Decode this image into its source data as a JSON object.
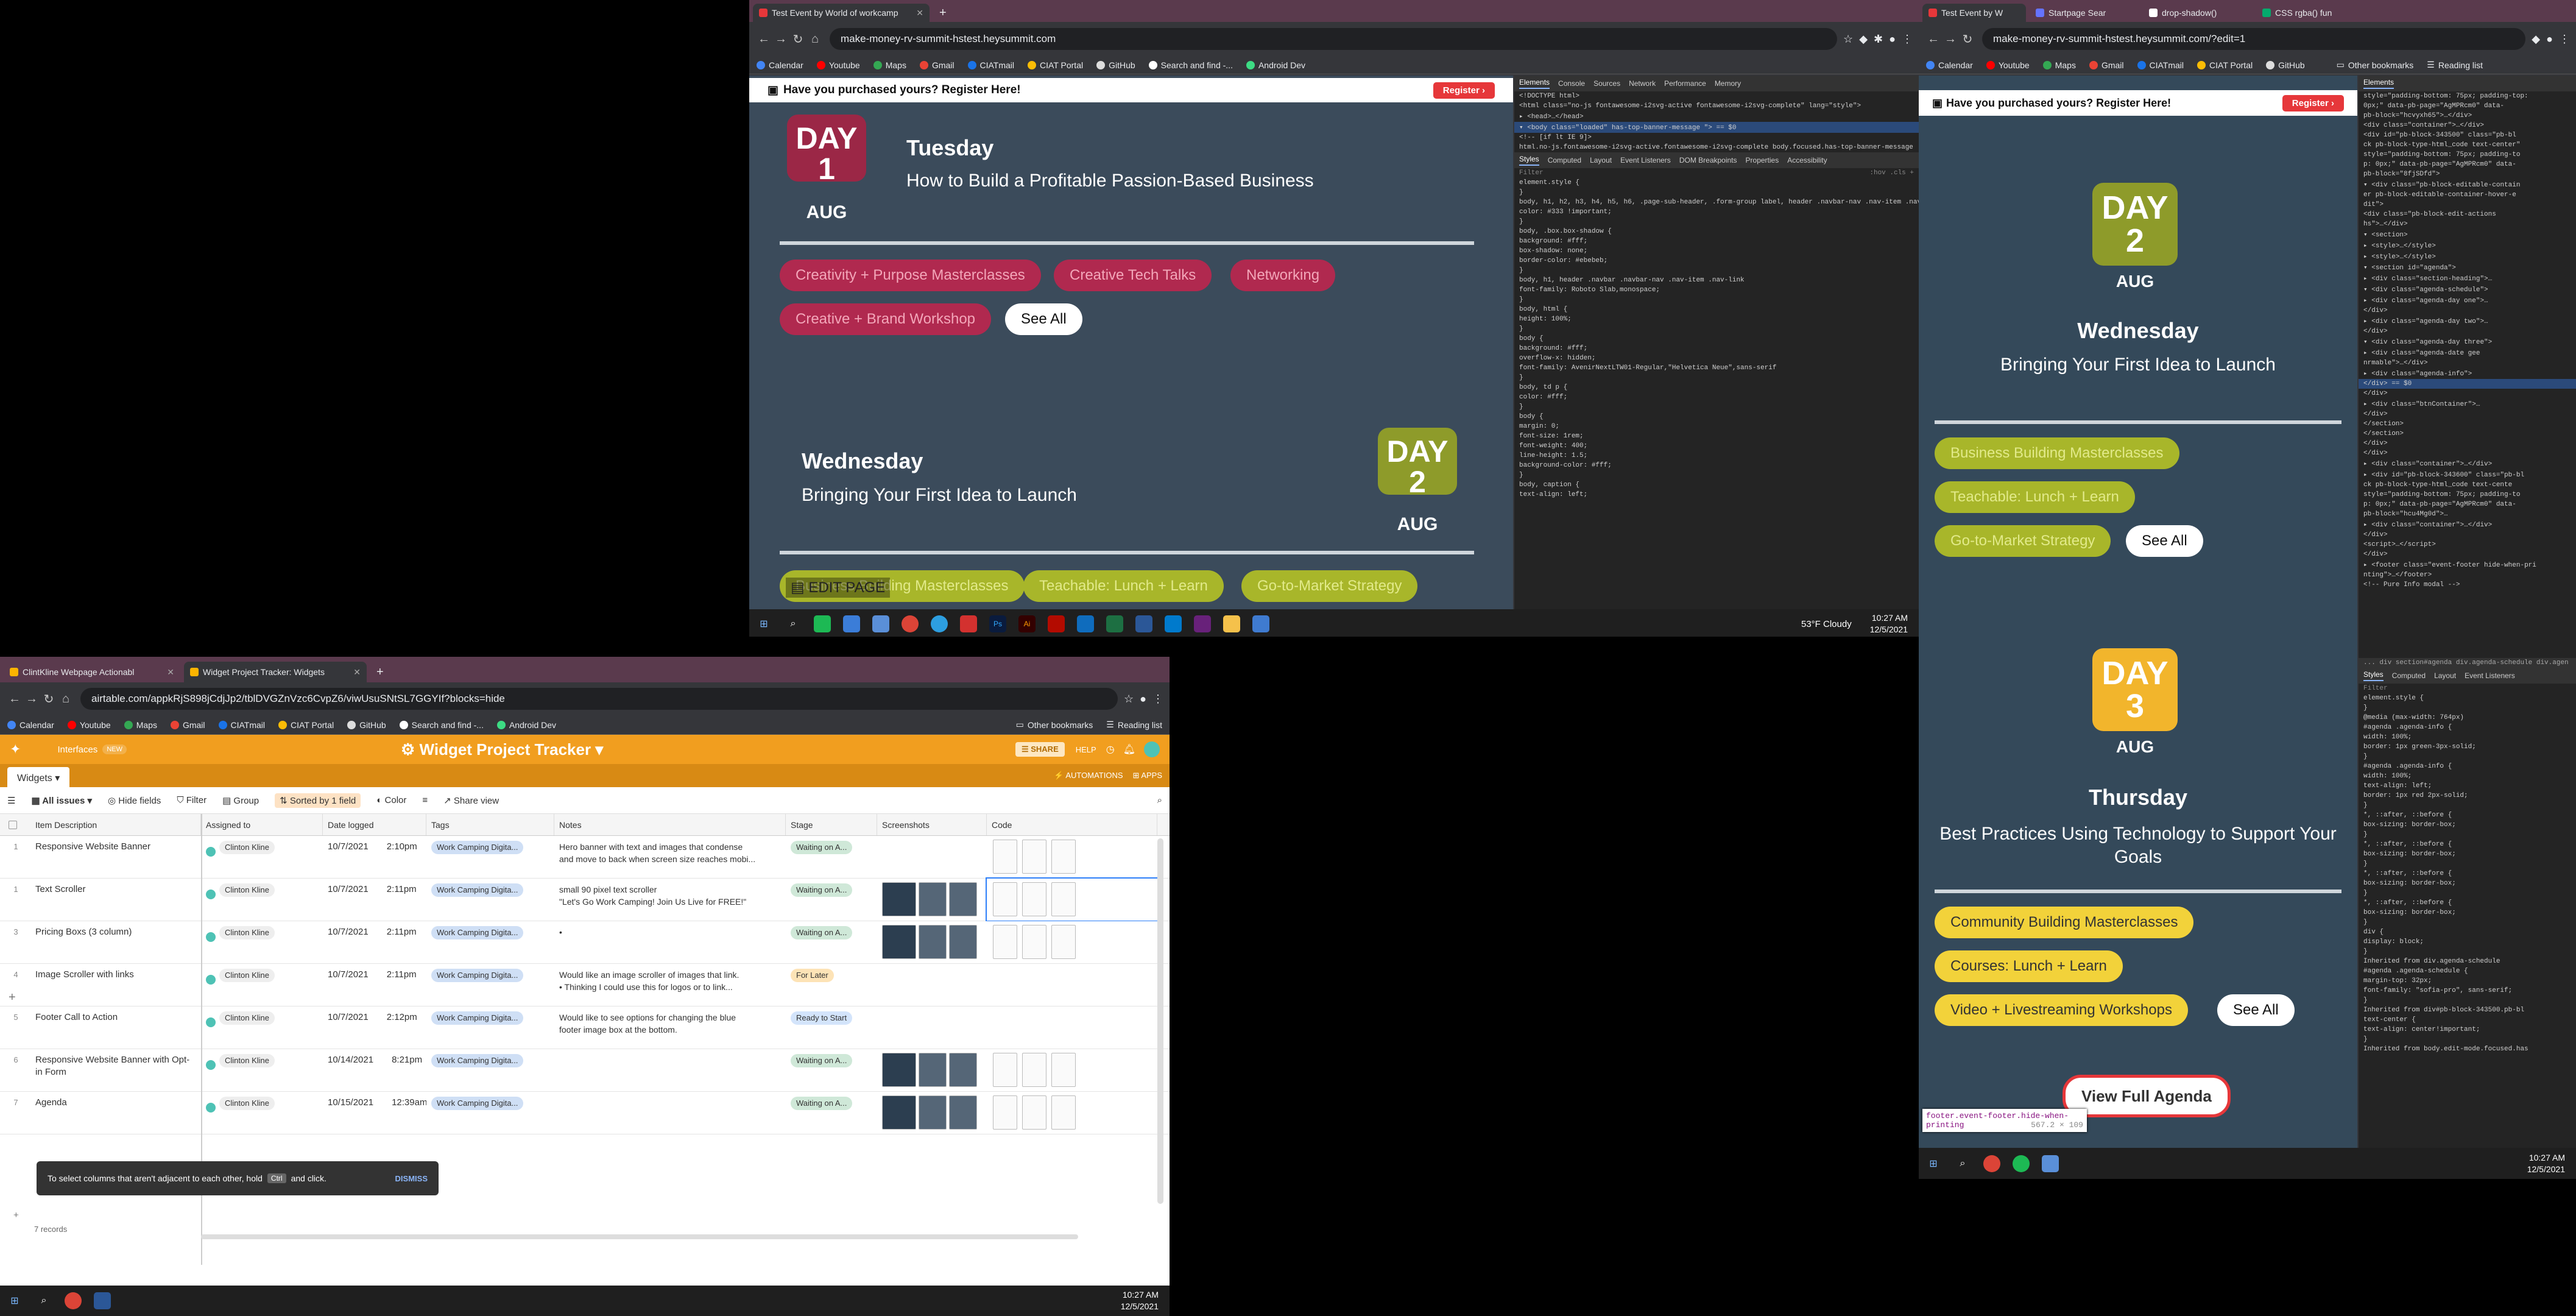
{
  "browser_top": {
    "tabs": [
      {
        "label": "Test Event by World of workcamp",
        "active": true
      }
    ],
    "url": "make-money-rv-summit-hstest.heysummit.com",
    "bookmarks": [
      "Calendar",
      "Youtube",
      "Maps",
      "Gmail",
      "CIATmail",
      "CIAT Portal",
      "GitHub",
      "Search and find -...",
      "Android Dev"
    ]
  },
  "browser_right": {
    "tabs": [
      {
        "label": "Test Event by W",
        "active": true
      },
      {
        "label": "Startpage Sear",
        "active": false
      },
      {
        "label": "drop-shadow()",
        "active": false
      },
      {
        "label": "CSS rgba() fun",
        "active": false
      }
    ],
    "url": "make-money-rv-summit-hstest.heysummit.com/?edit=1",
    "bookmarks": [
      "Calendar",
      "Youtube",
      "Maps",
      "Gmail",
      "CIATmail",
      "CIAT Portal",
      "GitHub"
    ],
    "other_bookmarks": "Other bookmarks",
    "reading_list": "Reading list"
  },
  "event": {
    "banner": "Have you purchased yours? Register Here!",
    "register": "Register",
    "day_word": "DAY",
    "aug": "AUG",
    "see_all": "See All",
    "edit_page": "EDIT PAGE",
    "view_full_agenda": "View Full Agenda",
    "days": [
      {
        "num": "1",
        "weekday": "Tuesday",
        "title": "How to Build a Profitable Passion-Based Business",
        "color": "#9b2746",
        "pill_color": "#b0294f",
        "tracks": [
          "Creativity + Purpose Masterclasses",
          "Creative Tech Talks",
          "Networking",
          "Creative + Brand Workshop"
        ]
      },
      {
        "num": "2",
        "weekday": "Wednesday",
        "title": "Bringing Your First Idea to Launch",
        "color": "#8e9b2a",
        "pill_color": "#a8b62a",
        "tracks": [
          "Business Building Masterclasses",
          "Teachable: Lunch + Learn",
          "Go-to-Market Strategy"
        ]
      },
      {
        "num": "3",
        "weekday": "Thursday",
        "title": "Best Practices Using Technology to Support Your Goals",
        "color": "#f2b52c",
        "pill_color": "#f2d23a",
        "tracks": [
          "Community Building Masterclasses",
          "Courses: Lunch + Learn",
          "Video + Livestreaming Workshops"
        ]
      }
    ]
  },
  "devtools_top": {
    "tabs": [
      "Elements",
      "Console",
      "Sources",
      "Network",
      "Performance",
      "Memory"
    ],
    "sub_tabs": [
      "Styles",
      "Computed",
      "Layout",
      "Event Listeners",
      "DOM Breakpoints",
      "Properties",
      "Accessibility"
    ],
    "filter": "Filter",
    "filter_hint": ":hov .cls +",
    "lines": [
      "<!DOCTYPE html>",
      "<html class=\"no-js fontawesome-i2svg-active fontawesome-i2svg-complete\" lang=\"style\">",
      "▸ <head>…</head>",
      "▾ <body class=\"loaded\" has-top-banner-message \"> == $0",
      "  <!-- [if lt IE 9]>",
      "html.no-js.fontawesome-i2svg-active.fontawesome-i2svg-complete   body.focused.has-top-banner-message",
      "element.style {",
      "}",
      "body, h1, h2, h3, h4, h5, h6, .page-sub-header, .form-group label, header .navbar-nav .nav-item .nav-link, footer ul li, .form-group .form-control, .bootstrap-select .dropdown-toggle",
      "  color: #333 !important;",
      "}",
      "body, .box.box-shadow {",
      "  background: #fff;",
      "  box-shadow: none;",
      "  border-color: #ebebeb;",
      "}",
      "body, h1, header .navbar .navbar-nav .nav-item .nav-link",
      "  font-family: Roboto Slab,monospace;",
      "}",
      "body, html {",
      "  height: 100%;",
      "}",
      "body {",
      "  background: #fff;",
      "  overflow-x: hidden;",
      "  font-family: AvenirNextLTW01-Regular,\"Helvetica Neue\",sans-serif",
      "}",
      "body, td p {",
      "  color: #fff;",
      "}",
      "body {",
      "  margin: 0;",
      "  font-size: 1rem;",
      "  font-weight: 400;",
      "  line-height: 1.5;",
      "  background-color: #fff;",
      "}",
      "body, caption {",
      "  text-align: left;"
    ]
  },
  "devtools_right": {
    "tabs": [
      "Elements"
    ],
    "lines": [
      "style=\"padding-bottom: 75px; padding-top:",
      "0px;\" data-pb-page=\"AgMPRcm0\" data-",
      "pb-block=\"hcvyxh65\">…</div>",
      "<div class=\"container\">…</div>",
      "<div id=\"pb-block-343500\" class=\"pb-bl",
      "ck pb-block-type-html_code text-center\"",
      "style=\"padding-bottom: 75px; padding-to",
      "p: 0px;\" data-pb-page=\"AgMPRcm0\" data-",
      "pb-block=\"8fjSDfd\">",
      "▾ <div class=\"pb-block-editable-contain",
      "er pb-block-editable-container-hover-e",
      "dit\">",
      "  <div class=\"pb-block-edit-actions",
      "  hs\">…</div>",
      "  ▾ <section>",
      "    ▸ <style>…</style>",
      "    ▸ <style>…</style>",
      "    ▾ <section id=\"agenda\">",
      "      ▸ <div class=\"section-heading\">…",
      "      ▾ <div class=\"agenda-schedule\">",
      "        ▸ <div class=\"agenda-day one\">…",
      "        </div>",
      "        ▸ <div class=\"agenda-day two\">…",
      "        </div>",
      "        ▾ <div class=\"agenda-day three\">",
      "          ▸ <div class=\"agenda-date gee",
      "          nrmable\">…</div>",
      "          ▸ <div class=\"agenda-info\">",
      "          </div> == $0",
      "        </div>",
      "        ▸ <div class=\"btnContainer\">…",
      "        </div>",
      "      </section>",
      "    </section>",
      "  </div>",
      "</div>",
      "▸ <div class=\"container\">…</div>",
      "▸ <div id=\"pb-block-343600\" class=\"pb-bl",
      "ck pb-block-type-html_code text-cente",
      "style=\"padding-bottom: 75px; padding-to",
      "p: 0px;\" data-pb-page=\"AgMPRcm0\" data-",
      "pb-block=\"hcu4Mg0d\">…",
      "▸ <div class=\"container\">…</div>",
      "</div>",
      "<script>…</script>",
      "</div>",
      "▸ <footer class=\"event-footer hide-when-pri",
      "nting\">…</footer>",
      "<!-- Pure Info modal -->"
    ],
    "breadcrumb": "... div   section#agenda   div.agenda-schedule   div.agen",
    "sub_tabs": [
      "Styles",
      "Computed",
      "Layout",
      "Event Listeners"
    ],
    "filter": "Filter",
    "css_lines": [
      "element.style {",
      "}",
      "@media (max-width: 764px)",
      "#agenda .agenda-info {",
      "  width: 100%;",
      "  border: 1px green-3px-solid;",
      "}",
      "#agenda .agenda-info {",
      "  width: 100%;",
      "  text-align: left;",
      "  border: 1px red 2px-solid;",
      "}",
      "*, ::after, ::before {",
      "  box-sizing: border-box;",
      "}",
      "*, ::after, ::before {",
      "  box-sizing: border-box;",
      "}",
      "*, ::after, ::before {",
      "  box-sizing: border-box;",
      "}",
      "*, ::after, ::before {",
      "  box-sizing: border-box;",
      "}",
      "div {",
      "  display: block;",
      "}",
      "Inherited from div.agenda-schedule",
      "#agenda .agenda-schedule {",
      "  margin-top: 32px;",
      "  font-family: \"sofia-pro\", sans-serif;",
      "}",
      "Inherited from div#pb-block-343500.pb-bl",
      "  text-center {",
      "  text-align: center!important;",
      "}",
      "Inherited from body.edit-mode.focused.has"
    ],
    "tooltip_selector": "footer.event-footer.hide-when-printing",
    "tooltip_size": "567.2 × 109"
  },
  "taskbar_top": {
    "weather": "53°F  Cloudy",
    "time": "10:27 AM",
    "date": "12/5/2021"
  },
  "taskbar_right": {
    "time": "10:27 AM",
    "date": "12/5/2021"
  },
  "taskbar_bottom": {
    "time": "10:27 AM",
    "date": "12/5/2021"
  },
  "browser_bottom": {
    "tabs": [
      {
        "label": "ClintKline Webpage Actionabl",
        "active": false
      },
      {
        "label": "Widget Project Tracker: Widgets",
        "active": true
      }
    ],
    "url": "airtable.com/appkRjS898jCdjJp2/tblDVGZnVzc6CvpZ6/viwUsuSNtSL7GGYIf?blocks=hide",
    "bookmarks": [
      "Calendar",
      "Youtube",
      "Maps",
      "Gmail",
      "CIATmail",
      "CIAT Portal",
      "GitHub",
      "Search and find -...",
      "Android Dev"
    ],
    "other_bookmarks": "Other bookmarks",
    "reading_list": "Reading list"
  },
  "airtable": {
    "interfaces": "Interfaces",
    "new": "NEW",
    "base_title": "Widget Project Tracker ▾",
    "share": "SHARE",
    "help": "HELP",
    "table_tab": "Widgets",
    "view": "All issues",
    "hide_fields": "Hide fields",
    "filter": "Filter",
    "group": "Group",
    "sorted": "Sorted by 1 field",
    "color": "Color",
    "share_view": "Share view",
    "automations": "AUTOMATIONS",
    "apps": "APPS",
    "columns": [
      "Item Description",
      "Assigned to",
      "Date logged",
      "Tags",
      "Notes",
      "Stage",
      "Screenshots",
      "Code"
    ],
    "rows": [
      {
        "n": "1",
        "item": "Responsive Website Banner",
        "user": "Clinton Kline",
        "date": "10/7/2021",
        "time": "2:10pm",
        "tag": "Work Camping Digita...",
        "notes": [
          "Hero banner with text and images that condense",
          "and move to back when screen size reaches mobi..."
        ],
        "stage": "Waiting on A...",
        "stage_color": "#cfe8d8"
      },
      {
        "n": "1",
        "item": "Text Scroller",
        "user": "Clinton Kline",
        "date": "10/7/2021",
        "time": "2:11pm",
        "tag": "Work Camping Digita...",
        "notes": [
          "small 90 pixel text scroller",
          "\"Let's Go Work Camping! Join Us Live for FREE!\""
        ],
        "stage": "Waiting on A...",
        "stage_color": "#cfe8d8"
      },
      {
        "n": "3",
        "item": "Pricing Boxs (3 column)",
        "user": "Clinton Kline",
        "date": "10/7/2021",
        "time": "2:11pm",
        "tag": "Work Camping Digita...",
        "notes": [
          "•",
          ""
        ],
        "stage": "Waiting on A...",
        "stage_color": "#cfe8d8"
      },
      {
        "n": "4",
        "item": "Image Scroller with links",
        "user": "Clinton Kline",
        "date": "10/7/2021",
        "time": "2:11pm",
        "tag": "Work Camping Digita...",
        "notes": [
          "Would like an image scroller of images that link.",
          "•   Thinking I could use this for logos or to link..."
        ],
        "stage": "For Later",
        "stage_color": "#fde3b6"
      },
      {
        "n": "5",
        "item": "Footer Call to Action",
        "user": "Clinton Kline",
        "date": "10/7/2021",
        "time": "2:12pm",
        "tag": "Work Camping Digita...",
        "notes": [
          "Would like to see options for changing the blue",
          "footer image box at the bottom."
        ],
        "stage": "Ready to Start",
        "stage_color": "#d3e4fb"
      },
      {
        "n": "6",
        "item": "Responsive Website Banner with Opt-in Form",
        "user": "Clinton Kline",
        "date": "10/14/2021",
        "time": "8:21pm",
        "tag": "Work Camping Digita...",
        "notes": [
          "",
          ""
        ],
        "stage": "Waiting on A...",
        "stage_color": "#cfe8d8"
      },
      {
        "n": "7",
        "item": "Agenda",
        "user": "Clinton Kline",
        "date": "10/15/2021",
        "time": "12:39am",
        "tag": "Work Camping Digita...",
        "notes": [
          "",
          ""
        ],
        "stage": "Waiting on A...",
        "stage_color": "#cfe8d8"
      }
    ],
    "toast": "To select columns that aren't adjacent to each other, hold",
    "toast_key": "Ctrl",
    "toast_tail": "and click.",
    "dismiss": "DISMISS",
    "records": "7 records"
  }
}
